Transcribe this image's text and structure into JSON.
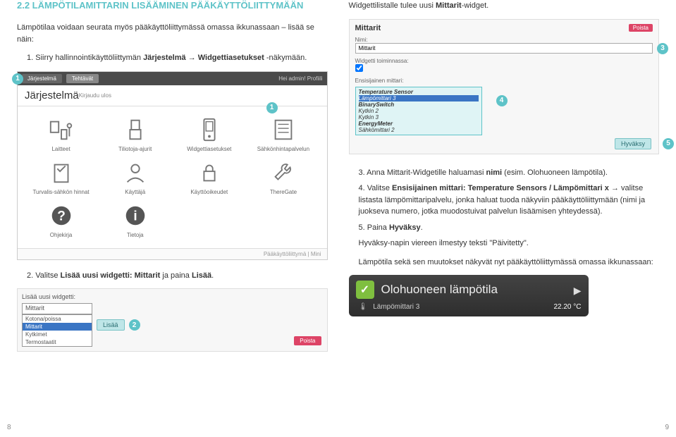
{
  "section_title": "2.2 LÄMPÖTILAMITTARIN LISÄÄMINEN PÄÄKÄYTTÖLIITTYMÄÄN",
  "intro": "Lämpötilaa voidaan seurata myös pääkäyttöliittymässä omassa ikkunassaan – lisää se näin:",
  "step1_a": "1.",
  "step1_b": "Siirry hallinnointikäyttöliittymän ",
  "step1_c": "Järjestelmä → Widgettiasetukset",
  "step1_d": " -näkymään.",
  "right_intro_a": "Widgettilistalle tulee uusi ",
  "right_intro_b": "Mittarit",
  "right_intro_c": "-widget.",
  "syspanel": {
    "tab_active": "Järjestelmä",
    "tab_inactive": "Tehtävät",
    "topright": "Hei admin! Profiili",
    "title": "Järjestelmä",
    "logout": "Kirjaudu ulos",
    "items": [
      "Laitteet",
      "Tiliotoja-ajurit",
      "Widgettiasetukset",
      "Sähkönhintapalvelun",
      "Turvalis-sähkön hinnat",
      "Käyttäjä",
      "Käyttöoikeudet",
      "ThereGate",
      "Ohjekirja",
      "Tietoja"
    ],
    "footer": "Pääkäyttöliittymä | Mini"
  },
  "step2_label": "2.",
  "step2_a": "Valitse ",
  "step2_b": "Lisää uusi widgetti: Mittarit",
  "step2_c": " ja paina ",
  "step2_d": "Lisää",
  "step2_e": ".",
  "dropdown": {
    "label": "Lisää uusi widgetti:",
    "selected": "Mittarit",
    "options": [
      "Mittarit",
      "Kotona/poissa",
      "Mittarit",
      "Kytkimet",
      "Termostaatit"
    ],
    "add": "Lisää",
    "del": "Poista"
  },
  "widgetconf": {
    "title": "Mittarit",
    "del": "Poista",
    "name_label": "Nimi:",
    "name_value": "Mittarit",
    "running_label": "Widgetti toiminnassa:",
    "primary_label": "Ensisijainen mittari:",
    "sensor_box_title": "Temperature Sensor",
    "sensor_sel": "Lämpömittari 3",
    "groups": [
      {
        "hdr": "BinarySwitch",
        "items": [
          "Kytkin 2",
          "Kytkin 3"
        ]
      },
      {
        "hdr": "EnergyMeter",
        "items": [
          "Sähkömittari 2"
        ]
      }
    ],
    "approve": "Hyväksy"
  },
  "step3_label": "3.",
  "step3_a": "Anna Mittarit-Widgetille haluamasi ",
  "step3_b": "nimi",
  "step3_c": " (esim. Olohuoneen lämpötila).",
  "step4_label": "4.",
  "step4_a": "Valitse ",
  "step4_b": "Ensisijainen mittari: Temperature Sensors / Lämpömittari x",
  "step4_c": " → valitse listasta lämpömittaripalvelu, jonka haluat tuoda näkyviin pääkäyttöliittymään (nimi ja juokseva numero, jotka muodostuivat palvelun lisäämisen yhteydessä).",
  "step5_label": "5.",
  "step5_a": "Paina ",
  "step5_b": "Hyväksy",
  "step5_c": ".",
  "post5": "Hyväksy-napin viereen ilmestyy teksti \"Päivitetty\".",
  "post6": "Lämpötila sekä sen muutokset näkyvät nyt pääkäyttöliittymässä omassa ikkunassaan:",
  "result": {
    "title": "Olohuoneen lämpötila",
    "subtitle": "Lämpömittari 3",
    "value": "22.20 °C"
  },
  "callouts": {
    "one": "1",
    "two": "2",
    "three": "3",
    "four": "4",
    "five": "5"
  },
  "page_left": "8",
  "page_right": "9"
}
